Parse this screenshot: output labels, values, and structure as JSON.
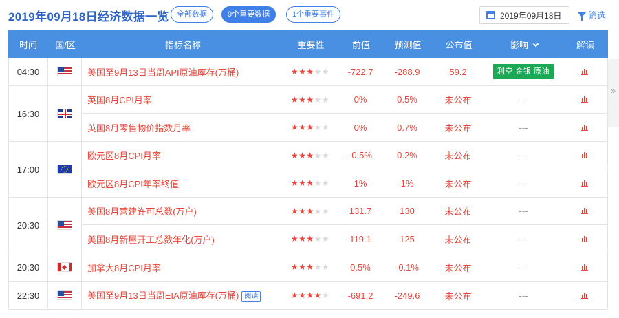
{
  "title": "2019年09月18日经济数据一览",
  "filters": {
    "all": "全部数据",
    "important_data": "9个重要数据",
    "important_events": "1个重要事件"
  },
  "date": "2019年09月18日",
  "filter_label": "筛选",
  "side_toggle": "»",
  "headers": {
    "time": "时间",
    "region": "国/区",
    "name": "指标名称",
    "importance": "重要性",
    "previous": "前值",
    "forecast": "预测值",
    "actual": "公布值",
    "effect": "影响",
    "interpret": "解读"
  },
  "rows": [
    {
      "time": "04:30",
      "flag": "us",
      "items": [
        {
          "name": "美国至9月13日当周API原油库存(万桶)",
          "stars": 3,
          "previous": "-722.7",
          "forecast": "-288.9",
          "actual": "59.2",
          "effect": "利空 金银 原油",
          "effect_badge": true
        }
      ]
    },
    {
      "time": "16:30",
      "flag": "uk",
      "items": [
        {
          "name": "英国8月CPI月率",
          "stars": 3,
          "previous": "0%",
          "forecast": "0.5%",
          "actual": "未公布",
          "effect": "---"
        },
        {
          "name": "英国8月零售物价指数月率",
          "stars": 3,
          "previous": "0%",
          "forecast": "0.7%",
          "actual": "未公布",
          "effect": "---"
        }
      ]
    },
    {
      "time": "17:00",
      "flag": "eu",
      "items": [
        {
          "name": "欧元区8月CPI月率",
          "stars": 3,
          "previous": "-0.5%",
          "forecast": "0.2%",
          "actual": "未公布",
          "effect": "---"
        },
        {
          "name": "欧元区8月CPI年率终值",
          "stars": 3,
          "previous": "1%",
          "forecast": "1%",
          "actual": "未公布",
          "effect": "---"
        }
      ]
    },
    {
      "time": "20:30",
      "flag": "us",
      "items": [
        {
          "name": "美国8月营建许可总数(万户)",
          "stars": 3,
          "previous": "131.7",
          "forecast": "130",
          "actual": "未公布",
          "effect": "---"
        },
        {
          "name": "美国8月新屋开工总数年化(万户)",
          "stars": 3,
          "previous": "119.1",
          "forecast": "125",
          "actual": "未公布",
          "effect": "---"
        }
      ]
    },
    {
      "time": "20:30",
      "flag": "ca",
      "items": [
        {
          "name": "加拿大8月CPI月率",
          "stars": 3,
          "previous": "0.5%",
          "forecast": "-0.1%",
          "actual": "未公布",
          "effect": "---"
        }
      ]
    },
    {
      "time": "22:30",
      "flag": "us",
      "items": [
        {
          "name": "美国至9月13日当周EIA原油库存(万桶)",
          "tag": "阅读",
          "stars": 4,
          "previous": "-691.2",
          "forecast": "-249.6",
          "actual": "未公布",
          "effect": "---"
        }
      ]
    }
  ]
}
